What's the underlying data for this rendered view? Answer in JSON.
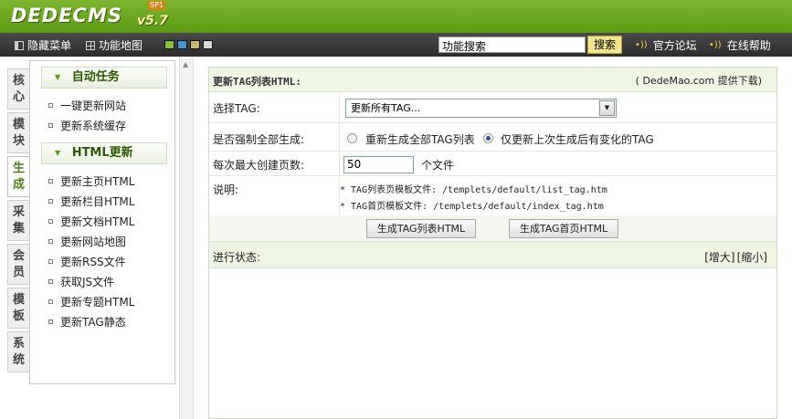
{
  "brand": {
    "logo_text": "DEDECMS",
    "version": "v5.7",
    "sp_badge": "SP1"
  },
  "toolbar": {
    "hide_menu": "隐藏菜单",
    "function_map": "功能地图",
    "skin_colors": [
      "#88c22c",
      "#3b98d6",
      "#c9b86a",
      "#d8d8d8"
    ],
    "search_placeholder": "功能搜索",
    "search_button": "搜索",
    "forum_link": "官方论坛",
    "help_link": "在线帮助"
  },
  "vtabs": [
    {
      "label": "核心"
    },
    {
      "label": "模块"
    },
    {
      "label": "生成",
      "active": true
    },
    {
      "label": "采集"
    },
    {
      "label": "会员"
    },
    {
      "label": "模板"
    },
    {
      "label": "系统"
    }
  ],
  "menu": {
    "group1_title": "自动任务",
    "group1_items": [
      "一键更新网站",
      "更新系统缓存"
    ],
    "group2_title": "HTML更新",
    "group2_items": [
      "更新主页HTML",
      "更新栏目HTML",
      "更新文档HTML",
      "更新网站地图",
      "更新RSS文件",
      "获取JS文件",
      "更新专题HTML",
      "更新TAG静态"
    ]
  },
  "main": {
    "title": "更新TAG列表HTML:",
    "download_link": "( DedeMao.com 提供下载)",
    "select_tag_label": "选择TAG:",
    "select_tag_value": "更新所有TAG...",
    "force_label": "是否强制全部生成:",
    "radio_all": "重新生成全部TAG列表",
    "radio_changed": "仅更新上次生成后有变化的TAG",
    "max_pages_label": "每次最大创建页数:",
    "max_pages_value": "50",
    "max_pages_unit": "个文件",
    "note_label": "说明:",
    "note_line1": "* TAG列表页模板文件: /templets/default/list_tag.htm",
    "note_line2": "* TAG首页模板文件: /templets/default/index_tag.htm",
    "btn_list": "生成TAG列表HTML",
    "btn_index": "生成TAG首页HTML",
    "status_label": "进行状态:",
    "enlarge": "[增大]",
    "shrink": "[缩小]"
  }
}
